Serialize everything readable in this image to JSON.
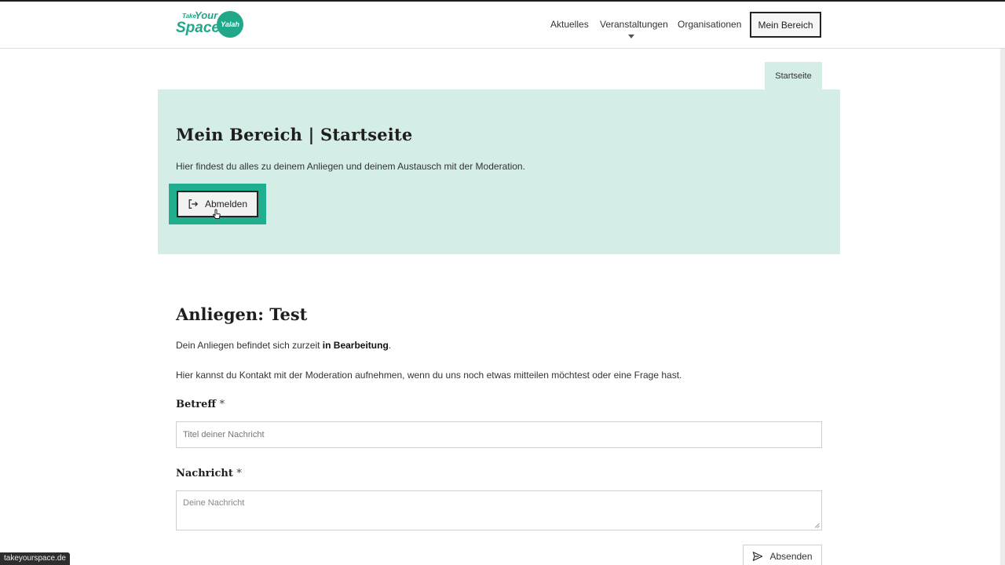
{
  "header": {
    "logo": {
      "take": "Take",
      "your": "Your",
      "space": "Space",
      "badge": "Yalah"
    },
    "nav": [
      {
        "label": "Aktuelles"
      },
      {
        "label": "Veranstaltungen"
      },
      {
        "label": "Organisationen"
      }
    ],
    "account_button": "Mein Bereich"
  },
  "tab": {
    "label": "Startseite"
  },
  "hero": {
    "title": "Mein Bereich | Startseite",
    "description": "Hier findest du alles zu deinem Anliegen und deinem Austausch mit der Moderation.",
    "logout_label": "Abmelden",
    "highlight_color": "#1fae8e",
    "background_color": "#d4ede7"
  },
  "concern": {
    "title": "Anliegen: Test",
    "status_prefix": "Dein Anliegen befindet sich zurzeit ",
    "status_value": "in Bearbeitung",
    "status_suffix": ".",
    "contact_text": "Hier kannst du Kontakt mit der Moderation aufnehmen, wenn du uns noch etwas mitteilen möchtest oder eine Frage hast."
  },
  "form": {
    "subject_label": "Betreff",
    "subject_required": "*",
    "subject_placeholder": "Titel deiner Nachricht",
    "message_label": "Nachricht",
    "message_required": "*",
    "message_placeholder": "Deine Nachricht",
    "submit_label": "Absenden"
  },
  "statusbar": {
    "url": "takeyourspace.de"
  },
  "icons": {
    "logout": "logout-icon",
    "send": "send-icon",
    "caret": "caret-down-icon",
    "cursor": "hand-cursor-icon"
  }
}
